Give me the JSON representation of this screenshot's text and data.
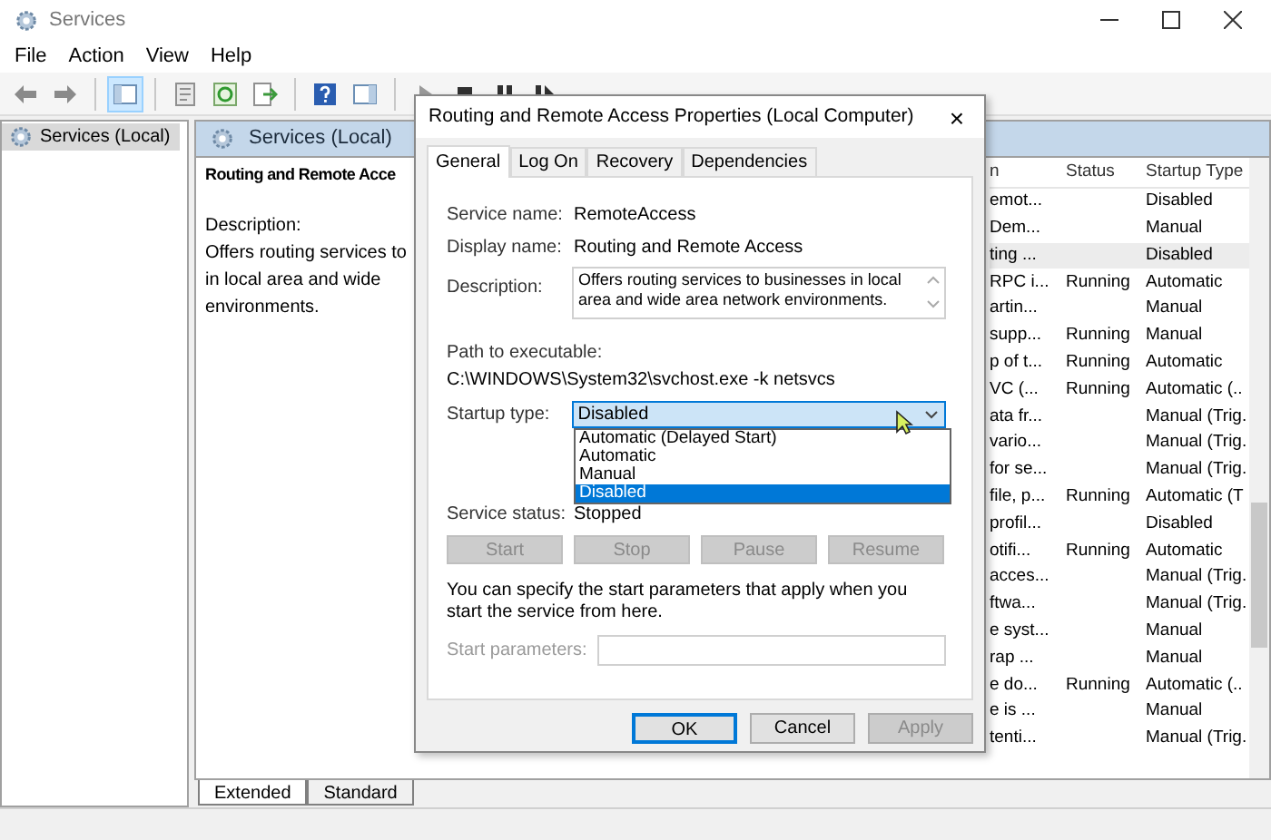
{
  "window": {
    "title": "Services"
  },
  "menu": [
    "File",
    "Action",
    "View",
    "Help"
  ],
  "toolbar": [
    {
      "kind": "back"
    },
    {
      "kind": "forward"
    },
    {
      "kind": "sep"
    },
    {
      "kind": "tree",
      "selected": true
    },
    {
      "kind": "sep"
    },
    {
      "kind": "props"
    },
    {
      "kind": "refresh"
    },
    {
      "kind": "export"
    },
    {
      "kind": "sep"
    },
    {
      "kind": "help"
    },
    {
      "kind": "pane"
    },
    {
      "kind": "sep"
    },
    {
      "kind": "play"
    },
    {
      "kind": "stop"
    },
    {
      "kind": "pause"
    },
    {
      "kind": "restart"
    }
  ],
  "tree": [
    {
      "label": "Services (Local)",
      "selected": true
    }
  ],
  "details": {
    "header": "Services (Local)",
    "service_title": "Routing and Remote Acce",
    "description_label": "Description:",
    "description_lines": [
      "Offers routing services to",
      "in local area and wide",
      "environments."
    ]
  },
  "table": {
    "columns": [
      "n",
      "Status",
      "Startup Type"
    ],
    "rows": [
      {
        "cells": [
          "emot...",
          "",
          "Disabled"
        ],
        "selected": false
      },
      {
        "cells": [
          "Dem...",
          "",
          "Manual"
        ],
        "selected": false
      },
      {
        "cells": [
          "ting ...",
          "",
          "Disabled"
        ],
        "selected": true
      },
      {
        "cells": [
          "RPC i...",
          "Running",
          "Automatic"
        ],
        "selected": false
      },
      {
        "cells": [
          "artin...",
          "",
          "Manual"
        ],
        "selected": false
      },
      {
        "cells": [
          "supp...",
          "Running",
          "Manual"
        ],
        "selected": false
      },
      {
        "cells": [
          "p of t...",
          "Running",
          "Automatic"
        ],
        "selected": false
      },
      {
        "cells": [
          "VC (...",
          "Running",
          "Automatic (.."
        ],
        "selected": false
      },
      {
        "cells": [
          "ata fr...",
          "",
          "Manual (Trig."
        ],
        "selected": false
      },
      {
        "cells": [
          "vario...",
          "",
          "Manual (Trig."
        ],
        "selected": false
      },
      {
        "cells": [
          "for se...",
          "",
          "Manual (Trig."
        ],
        "selected": false
      },
      {
        "cells": [
          "file, p...",
          "Running",
          "Automatic (T"
        ],
        "selected": false
      },
      {
        "cells": [
          "profil...",
          "",
          "Disabled"
        ],
        "selected": false
      },
      {
        "cells": [
          "otifi...",
          "Running",
          "Automatic"
        ],
        "selected": false
      },
      {
        "cells": [
          "acces...",
          "",
          "Manual (Trig."
        ],
        "selected": false
      },
      {
        "cells": [
          "ftwa...",
          "",
          "Manual (Trig."
        ],
        "selected": false
      },
      {
        "cells": [
          "e syst...",
          "",
          "Manual"
        ],
        "selected": false
      },
      {
        "cells": [
          "rap ...",
          "",
          "Manual"
        ],
        "selected": false
      },
      {
        "cells": [
          "e do...",
          "Running",
          "Automatic (.."
        ],
        "selected": false
      },
      {
        "cells": [
          "e is ...",
          "",
          "Manual"
        ],
        "selected": false
      },
      {
        "cells": [
          "tenti...",
          "",
          "Manual (Trig."
        ],
        "selected": false
      }
    ]
  },
  "view_tabs": [
    {
      "label": "Extended",
      "selected": true
    },
    {
      "label": "Standard",
      "selected": false
    }
  ],
  "dialog": {
    "title": "Routing and Remote Access Properties (Local Computer)",
    "close": "×",
    "tabs": [
      {
        "label": "General",
        "selected": true
      },
      {
        "label": "Log On",
        "selected": false
      },
      {
        "label": "Recovery",
        "selected": false
      },
      {
        "label": "Dependencies",
        "selected": false
      }
    ],
    "service_name_label": "Service name:",
    "service_name": "RemoteAccess",
    "display_name_label": "Display name:",
    "display_name": "Routing and Remote Access",
    "description_label": "Description:",
    "description": "Offers routing services to businesses in local area and wide area network environments.",
    "path_label": "Path to executable:",
    "path": "C:\\WINDOWS\\System32\\svchost.exe -k netsvcs",
    "startup_label": "Startup type:",
    "startup_value": "Disabled",
    "startup_expanded": true,
    "startup_options": [
      {
        "label": "Automatic (Delayed Start)",
        "selected": false
      },
      {
        "label": "Automatic",
        "selected": false
      },
      {
        "label": "Manual",
        "selected": false
      },
      {
        "label": "Disabled",
        "selected": true
      }
    ],
    "status_label": "Service status:",
    "status": "Stopped",
    "control_buttons": [
      {
        "label": "Start",
        "disabled": true
      },
      {
        "label": "Stop",
        "disabled": true
      },
      {
        "label": "Pause",
        "disabled": true
      },
      {
        "label": "Resume",
        "disabled": true
      }
    ],
    "note": "You can specify the start parameters that apply when you start the service from here.",
    "params_label": "Start parameters:",
    "params_disabled": true,
    "buttons": [
      {
        "label": "OK",
        "default": true,
        "disabled": false
      },
      {
        "label": "Cancel",
        "default": false,
        "disabled": false
      },
      {
        "label": "Apply",
        "default": false,
        "disabled": true
      }
    ]
  }
}
